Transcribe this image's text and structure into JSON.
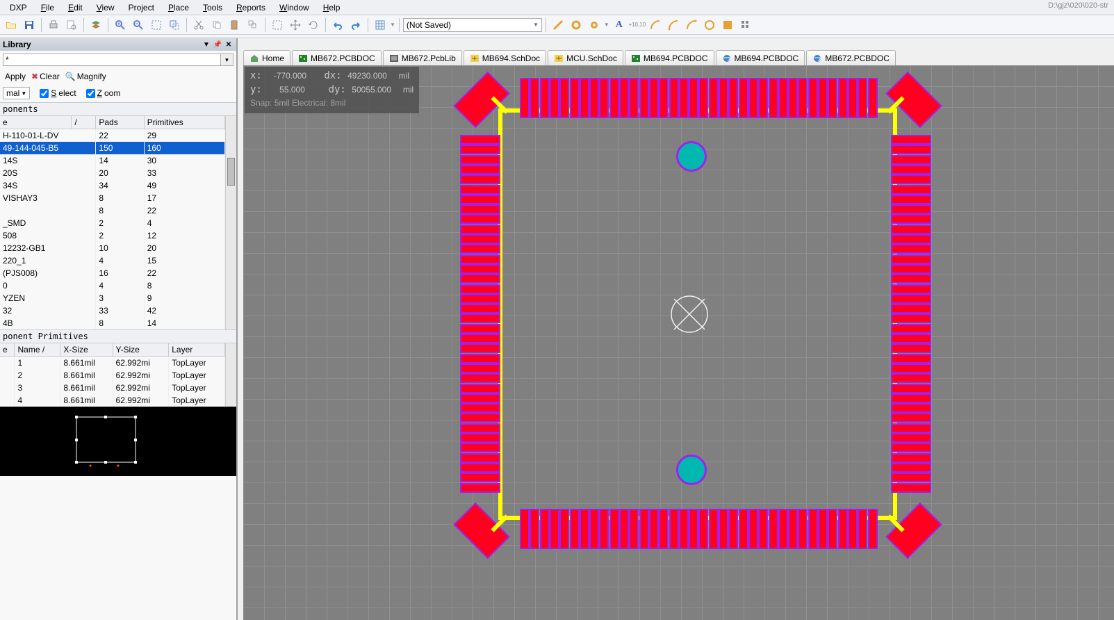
{
  "menu": {
    "items": [
      "DXP",
      "File",
      "Edit",
      "View",
      "Project",
      "Place",
      "Tools",
      "Reports",
      "Window",
      "Help"
    ]
  },
  "titlePath": "D:\\gjz\\020\\020-str",
  "dropdown": {
    "text": "(Not Saved)"
  },
  "tabs": [
    {
      "label": "Home",
      "icon": "home"
    },
    {
      "label": "MB672.PCBDOC",
      "icon": "pcb"
    },
    {
      "label": "MB672.PcbLib",
      "icon": "lib"
    },
    {
      "label": "MB694.SchDoc",
      "icon": "sch"
    },
    {
      "label": "MCU.SchDoc",
      "icon": "sch"
    },
    {
      "label": "MB694.PCBDOC",
      "icon": "pcb"
    },
    {
      "label": "MB694.PCBDOC",
      "icon": "ie"
    },
    {
      "label": "MB672.PCBDOC",
      "icon": "ie"
    }
  ],
  "library": {
    "title": "Library",
    "filter": "*",
    "apply": "Apply",
    "clear": "Clear",
    "magnify": "Magnify",
    "mode": "mal",
    "select": "Select",
    "zoom": "Zoom",
    "componentsHeader": "ponents",
    "cols": [
      "e",
      "Pads",
      "Primitives"
    ],
    "rows": [
      {
        "n": "H-110-01-L-DV",
        "p": "22",
        "pr": "29"
      },
      {
        "n": "49-144-045-B5",
        "p": "150",
        "pr": "160",
        "sel": true
      },
      {
        "n": "14S",
        "p": "14",
        "pr": "30"
      },
      {
        "n": "20S",
        "p": "20",
        "pr": "33"
      },
      {
        "n": "34S",
        "p": "34",
        "pr": "49"
      },
      {
        "n": "VISHAY3",
        "p": "8",
        "pr": "17"
      },
      {
        "n": "",
        "p": "8",
        "pr": "22"
      },
      {
        "n": "_SMD",
        "p": "2",
        "pr": "4"
      },
      {
        "n": "508",
        "p": "2",
        "pr": "12"
      },
      {
        "n": "12232-GB1",
        "p": "10",
        "pr": "20"
      },
      {
        "n": "220_1",
        "p": "4",
        "pr": "15"
      },
      {
        "n": "(PJS008)",
        "p": "16",
        "pr": "22"
      },
      {
        "n": "0",
        "p": "4",
        "pr": "8"
      },
      {
        "n": "YZEN",
        "p": "3",
        "pr": "9"
      },
      {
        "n": "32",
        "p": "33",
        "pr": "42"
      },
      {
        "n": "4B",
        "p": "8",
        "pr": "14"
      }
    ],
    "primHeader": "ponent Primitives",
    "primCols": [
      "e",
      "Name",
      "X-Size",
      "Y-Size",
      "Layer"
    ],
    "primRows": [
      {
        "t": "",
        "n": "1",
        "x": "8.661mil",
        "y": "62.992mi",
        "l": "TopLayer"
      },
      {
        "t": "",
        "n": "2",
        "x": "8.661mil",
        "y": "62.992mi",
        "l": "TopLayer"
      },
      {
        "t": "",
        "n": "3",
        "x": "8.661mil",
        "y": "62.992mi",
        "l": "TopLayer"
      },
      {
        "t": "",
        "n": "4",
        "x": "8.661mil",
        "y": "62.992mi",
        "l": "TopLayer"
      }
    ]
  },
  "coord": {
    "x": "-770.000",
    "dx": "49230.000",
    "unit": "mil",
    "y": "55.000",
    "dy": "50055.000",
    "snap": "Snap: 5mil Electrical: 8mil"
  }
}
